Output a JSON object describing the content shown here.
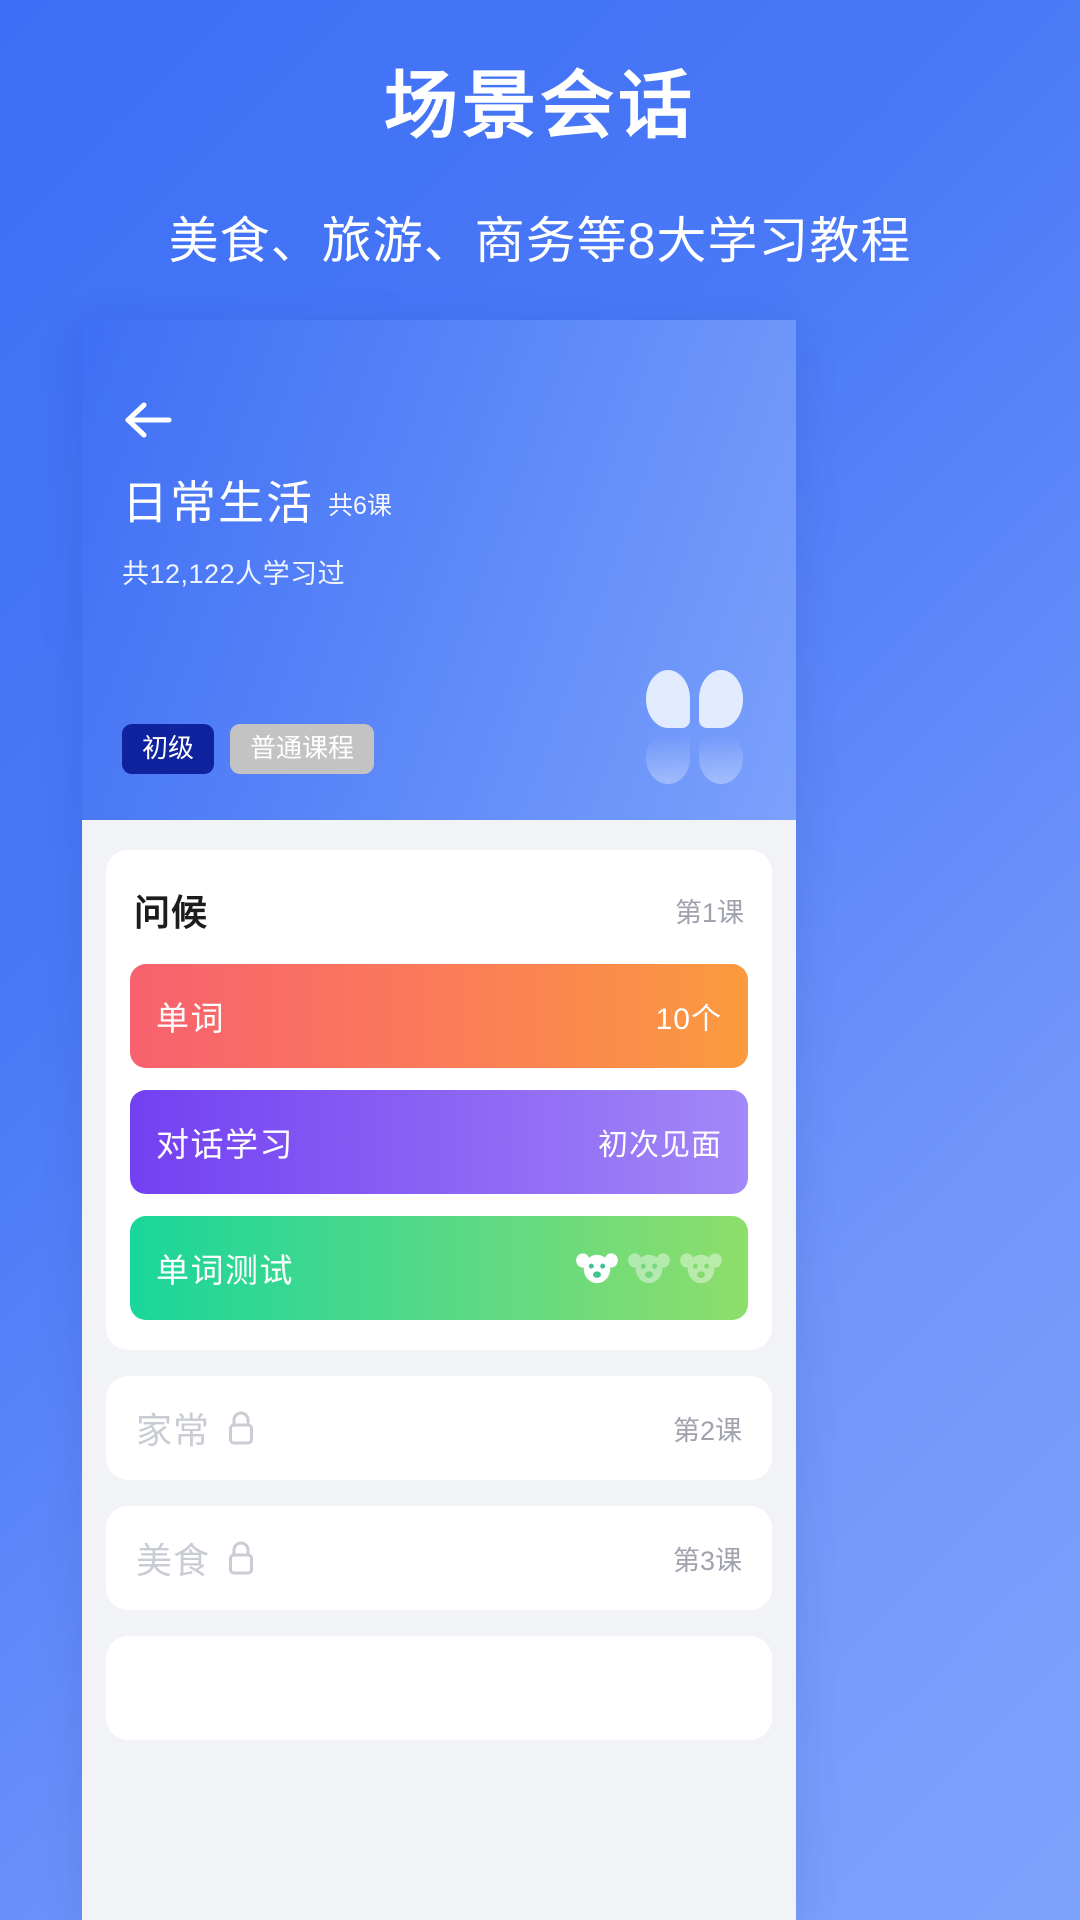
{
  "promo": {
    "title": "场景会话",
    "subtitle": "美食、旅游、商务等8大学习教程"
  },
  "colors": {
    "page_gradient_from": "#3d6ef5",
    "page_gradient_to": "#7ea3fc",
    "hero_gradient_from": "#3f6ff5",
    "hero_gradient_to": "#7ba1fc",
    "body_background": "#f2f3f7",
    "card_background": "#ffffff",
    "tag_level_bg": "#10239e",
    "tag_type_bg": "#c3c3c3",
    "row_words_from": "#f8616f",
    "row_words_to": "#fb9a3e",
    "row_dialog_from": "#7340f2",
    "row_dialog_to": "#a288f8",
    "row_quiz_from": "#19d69b",
    "row_quiz_to": "#8ede6a",
    "locked_text": "#c9ccd4",
    "muted_text": "#a0a3ad"
  },
  "hero": {
    "back_icon": "arrow-left-icon",
    "title": "日常生活",
    "lesson_count": "共6课",
    "learners": "共12,122人学习过",
    "tags": [
      {
        "label": "初级",
        "style": "level"
      },
      {
        "label": "普通课程",
        "style": "type"
      }
    ],
    "decoration_icon": "quote-blob-icon"
  },
  "lesson": {
    "name": "问候",
    "index_label": "第1课",
    "activities": [
      {
        "label": "单词",
        "value": "10个",
        "style": "words",
        "icon": ""
      },
      {
        "label": "对话学习",
        "value": "初次见面",
        "style": "dialog",
        "icon": ""
      },
      {
        "label": "单词测试",
        "value": "",
        "style": "quiz",
        "icon": "koala-face-icon",
        "icon_count": 3,
        "icon_active": 1
      }
    ]
  },
  "locked_lessons": [
    {
      "name": "家常",
      "index_label": "第2课",
      "icon": "lock-icon"
    },
    {
      "name": "美食",
      "index_label": "第3课",
      "icon": "lock-icon"
    }
  ]
}
